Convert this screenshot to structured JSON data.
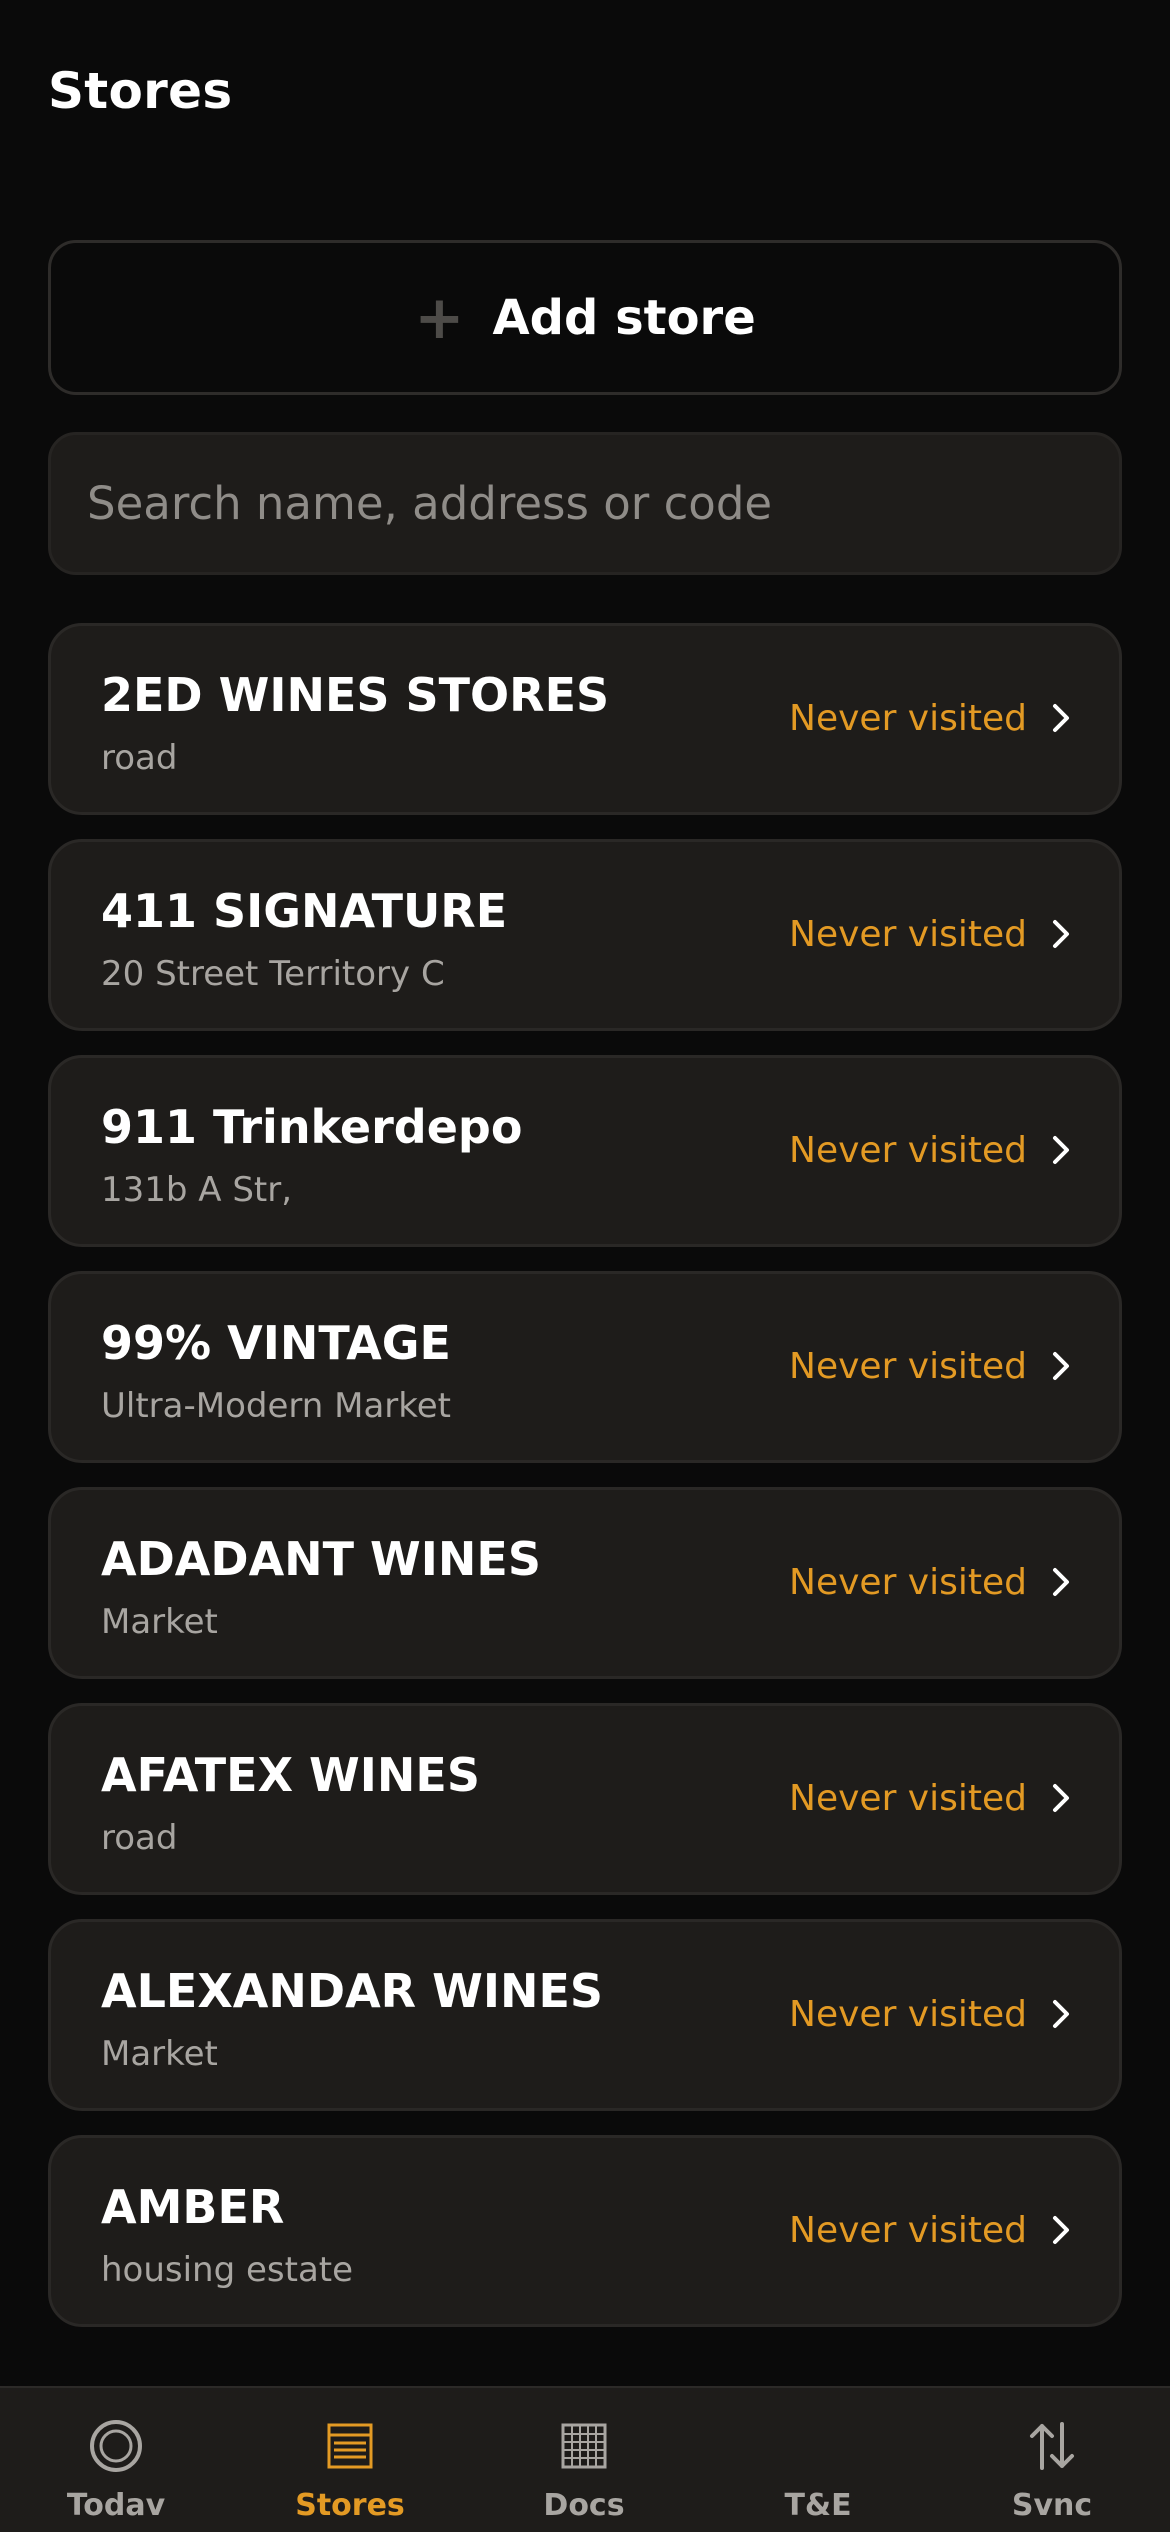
{
  "header": {
    "title": "Stores"
  },
  "actions": {
    "add_store_label": "Add store"
  },
  "search": {
    "placeholder": "Search name, address or code",
    "value": ""
  },
  "stores": [
    {
      "name": "2ED WINES STORES",
      "address": "road",
      "status": "Never visited"
    },
    {
      "name": "411 SIGNATURE",
      "address": "20 Street Territory C",
      "status": "Never visited"
    },
    {
      "name": "911 Trinkerdepo",
      "address": "131b A Str,",
      "status": "Never visited"
    },
    {
      "name": "99% VINTAGE",
      "address": "Ultra-Modern Market",
      "status": "Never visited"
    },
    {
      "name": "ADADANT WINES",
      "address": "Market",
      "status": "Never visited"
    },
    {
      "name": "AFATEX WINES",
      "address": "road",
      "status": "Never visited"
    },
    {
      "name": "ALEXANDAR WINES",
      "address": "Market",
      "status": "Never visited"
    },
    {
      "name": "AMBER",
      "address": "housing estate",
      "status": "Never visited"
    }
  ],
  "tabs": [
    {
      "label": "Todav",
      "icon": "circle-icon",
      "active": false
    },
    {
      "label": "Stores",
      "icon": "store-list-icon",
      "active": true
    },
    {
      "label": "Docs",
      "icon": "grid-icon",
      "active": false
    },
    {
      "label": "T&E",
      "icon": "",
      "active": false
    },
    {
      "label": "Svnc",
      "icon": "sync-arrows-icon",
      "active": false
    }
  ],
  "colors": {
    "background": "#0a0a0a",
    "card": "#1e1c1a",
    "accent": "#e39a24",
    "secondary_text": "#a8a5a1"
  }
}
